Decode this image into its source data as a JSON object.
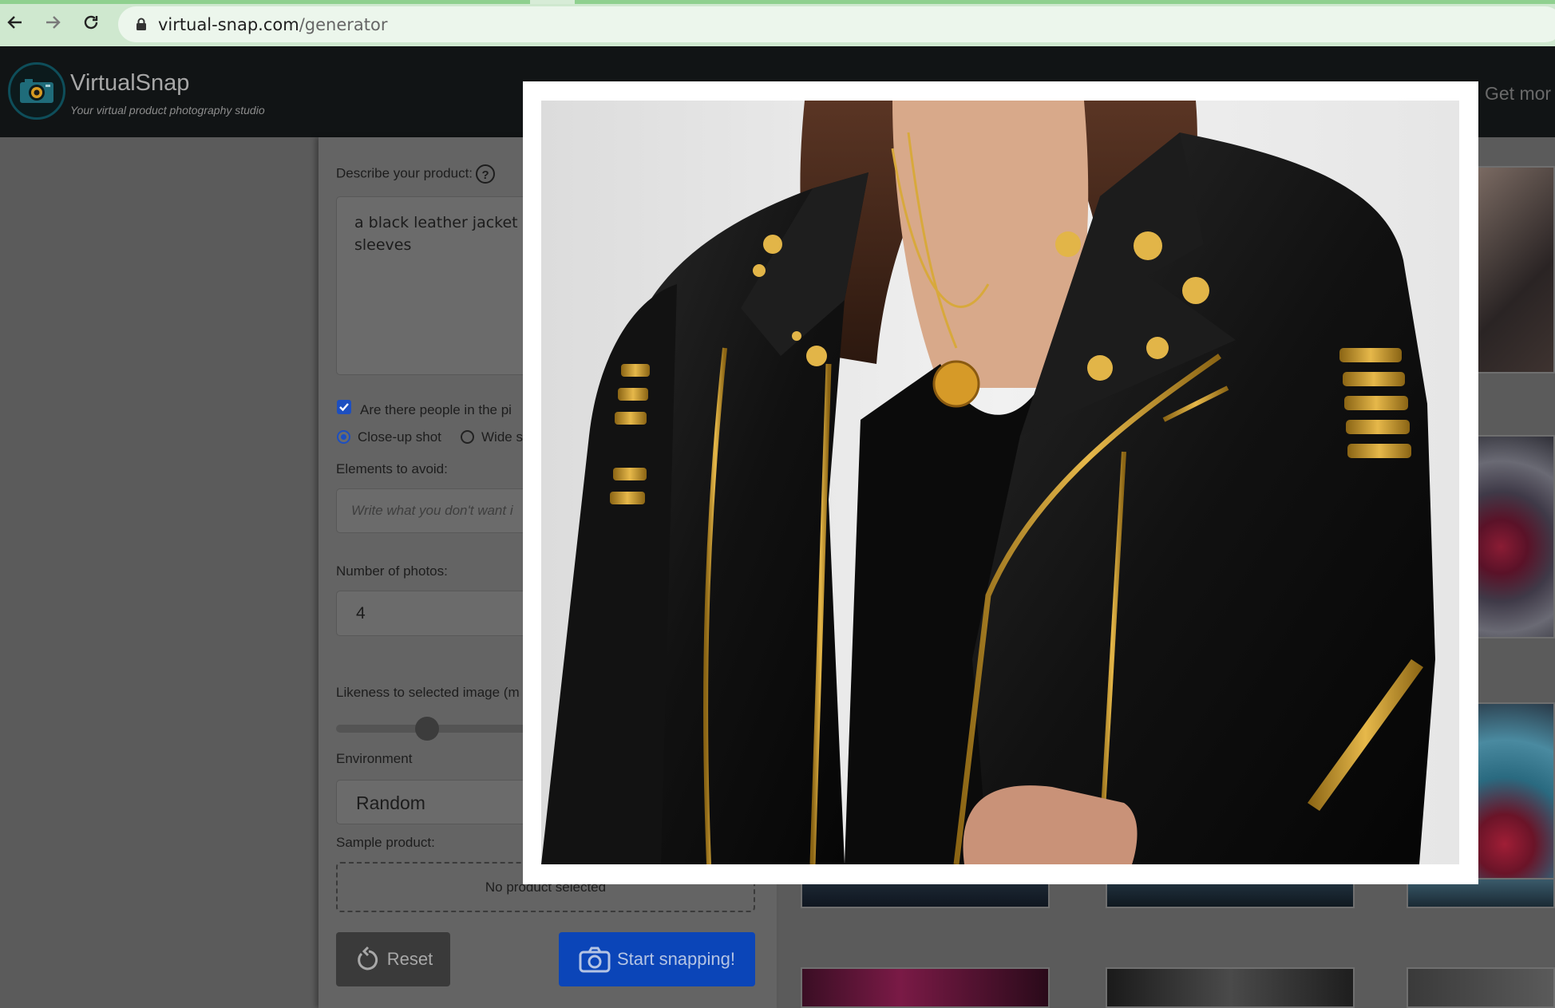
{
  "browser": {
    "url_domain": "virtual-snap.com",
    "url_path": "/generator"
  },
  "app": {
    "name": "VirtualSnap",
    "tagline": "Your virtual product photography studio",
    "nav_link": "Get mor"
  },
  "form": {
    "describe_label": "Describe your product:",
    "help_symbol": "?",
    "description_value": "a black leather jacket wi",
    "description_value_line2": "sleeves",
    "people_checkbox_label": "Are there people in the pi",
    "people_checked": true,
    "shot_options": [
      {
        "label": "Close-up shot",
        "selected": true
      },
      {
        "label": "Wide s",
        "selected": false
      }
    ],
    "avoid_label": "Elements to avoid:",
    "avoid_placeholder": "Write what you don't want i",
    "photos_label": "Number of photos:",
    "photos_value": "4",
    "likeness_label": "Likeness to selected image (m",
    "likeness_level": 0.45,
    "environment_label": "Environment",
    "environment_value": "Random",
    "sample_label": "Sample product:",
    "sample_value": "No product selected",
    "reset_label": "Reset",
    "start_label": "Start snapping!"
  },
  "modal": {
    "image_subject": "woman wearing black leather jacket with gold zippers and studs"
  },
  "colors": {
    "accent": "#0b45b8",
    "header_bg": "#111415",
    "overlay": "#5b5b5b",
    "modal_bg": "#ffffff"
  },
  "icons": [
    "back-arrow-icon",
    "forward-arrow-icon",
    "reload-icon",
    "lock-icon",
    "camera-logo-icon",
    "reset-icon",
    "camera-icon"
  ]
}
